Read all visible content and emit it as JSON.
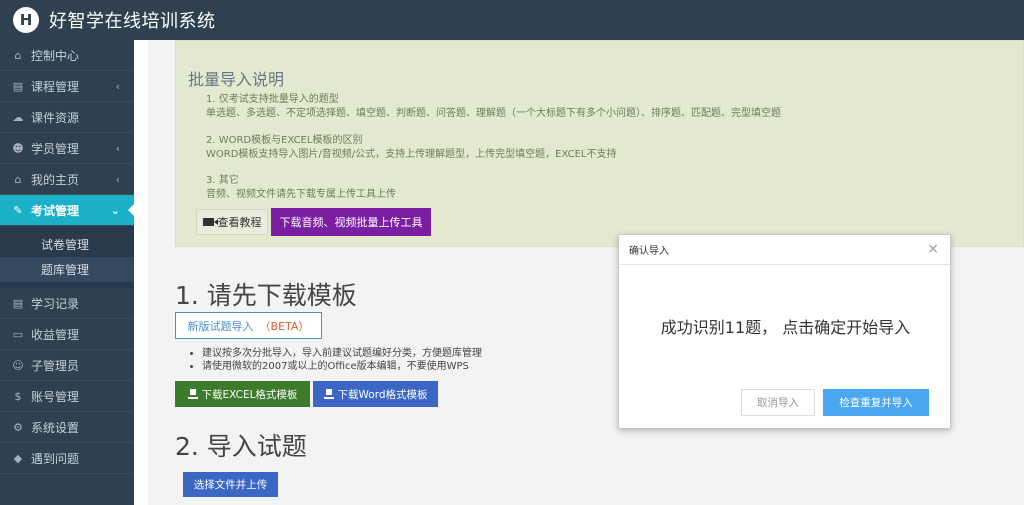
{
  "header": {
    "logo_letter": "H",
    "title": "好智学在线培训系统"
  },
  "sidebar": {
    "items": [
      {
        "label": "控制中心",
        "icon": "home-icon",
        "glyph": "⌂",
        "chevron": false
      },
      {
        "label": "课程管理",
        "icon": "book-icon",
        "glyph": "▤",
        "chevron": true
      },
      {
        "label": "课件资源",
        "icon": "cloud-icon",
        "glyph": "☁",
        "chevron": false
      },
      {
        "label": "学员管理",
        "icon": "users-icon",
        "glyph": "☻",
        "chevron": true
      },
      {
        "label": "我的主页",
        "icon": "graduation-cap-icon",
        "glyph": "⌂",
        "chevron": true
      },
      {
        "label": "考试管理",
        "icon": "tag-icon",
        "glyph": "✎",
        "chevron": true,
        "active": true
      }
    ],
    "sub_items": [
      {
        "label": "试卷管理"
      },
      {
        "label": "题库管理",
        "selected": true
      }
    ],
    "items_after": [
      {
        "label": "学习记录",
        "icon": "book-icon",
        "glyph": "▤"
      },
      {
        "label": "收益管理",
        "icon": "credit-card-icon",
        "glyph": "▭"
      },
      {
        "label": "子管理员",
        "icon": "user-icon",
        "glyph": "☺"
      },
      {
        "label": "账号管理",
        "icon": "dollar-icon",
        "glyph": "$"
      },
      {
        "label": "系统设置",
        "icon": "gear-icon",
        "glyph": "⚙"
      },
      {
        "label": "遇到问题",
        "icon": "question-icon",
        "glyph": "◆"
      }
    ],
    "chevron_glyph": "‹",
    "chevron_active_glyph": "⌄"
  },
  "info": {
    "title": "批量导入说明",
    "sections": [
      {
        "heading": "1. 仅考试支持批量导入的题型",
        "text": "单选题、多选题、不定项选择题、填空题、判断题、问答题、理解题（一个大标题下有多个小问题）、排序题、匹配题、完型填空题"
      },
      {
        "heading": "2. WORD模板与EXCEL模板的区别",
        "text": "WORD模板支持导入图片/音视频/公式，支持上传理解题型，上传完型填空题，EXCEL不支持"
      },
      {
        "heading": "3. 其它",
        "text": "音频、视频文件请先下载专属上传工具上传"
      }
    ],
    "video_button": "查看教程",
    "purple_button": "下载音频、视频批量上传工具"
  },
  "step1": {
    "title": "1. 请先下载模板",
    "beta_button": "新版试题导入",
    "beta_tag": "（BETA）",
    "bullets": [
      "建议按多次分批导入，导入前建议试题编好分类，方便题库管理",
      "请使用微软的2007或以上的Office版本编辑，不要使用WPS"
    ],
    "excel_button": "下载EXCEL格式模板",
    "word_button": "下载Word格式模板"
  },
  "step2": {
    "title": "2. 导入试题",
    "upload_button": "选择文件并上传"
  },
  "modal": {
    "title": "确认导入",
    "close": "×",
    "message": "成功识别11题， 点击确定开始导入",
    "cancel": "取消导入",
    "confirm": "检查重复并导入"
  }
}
